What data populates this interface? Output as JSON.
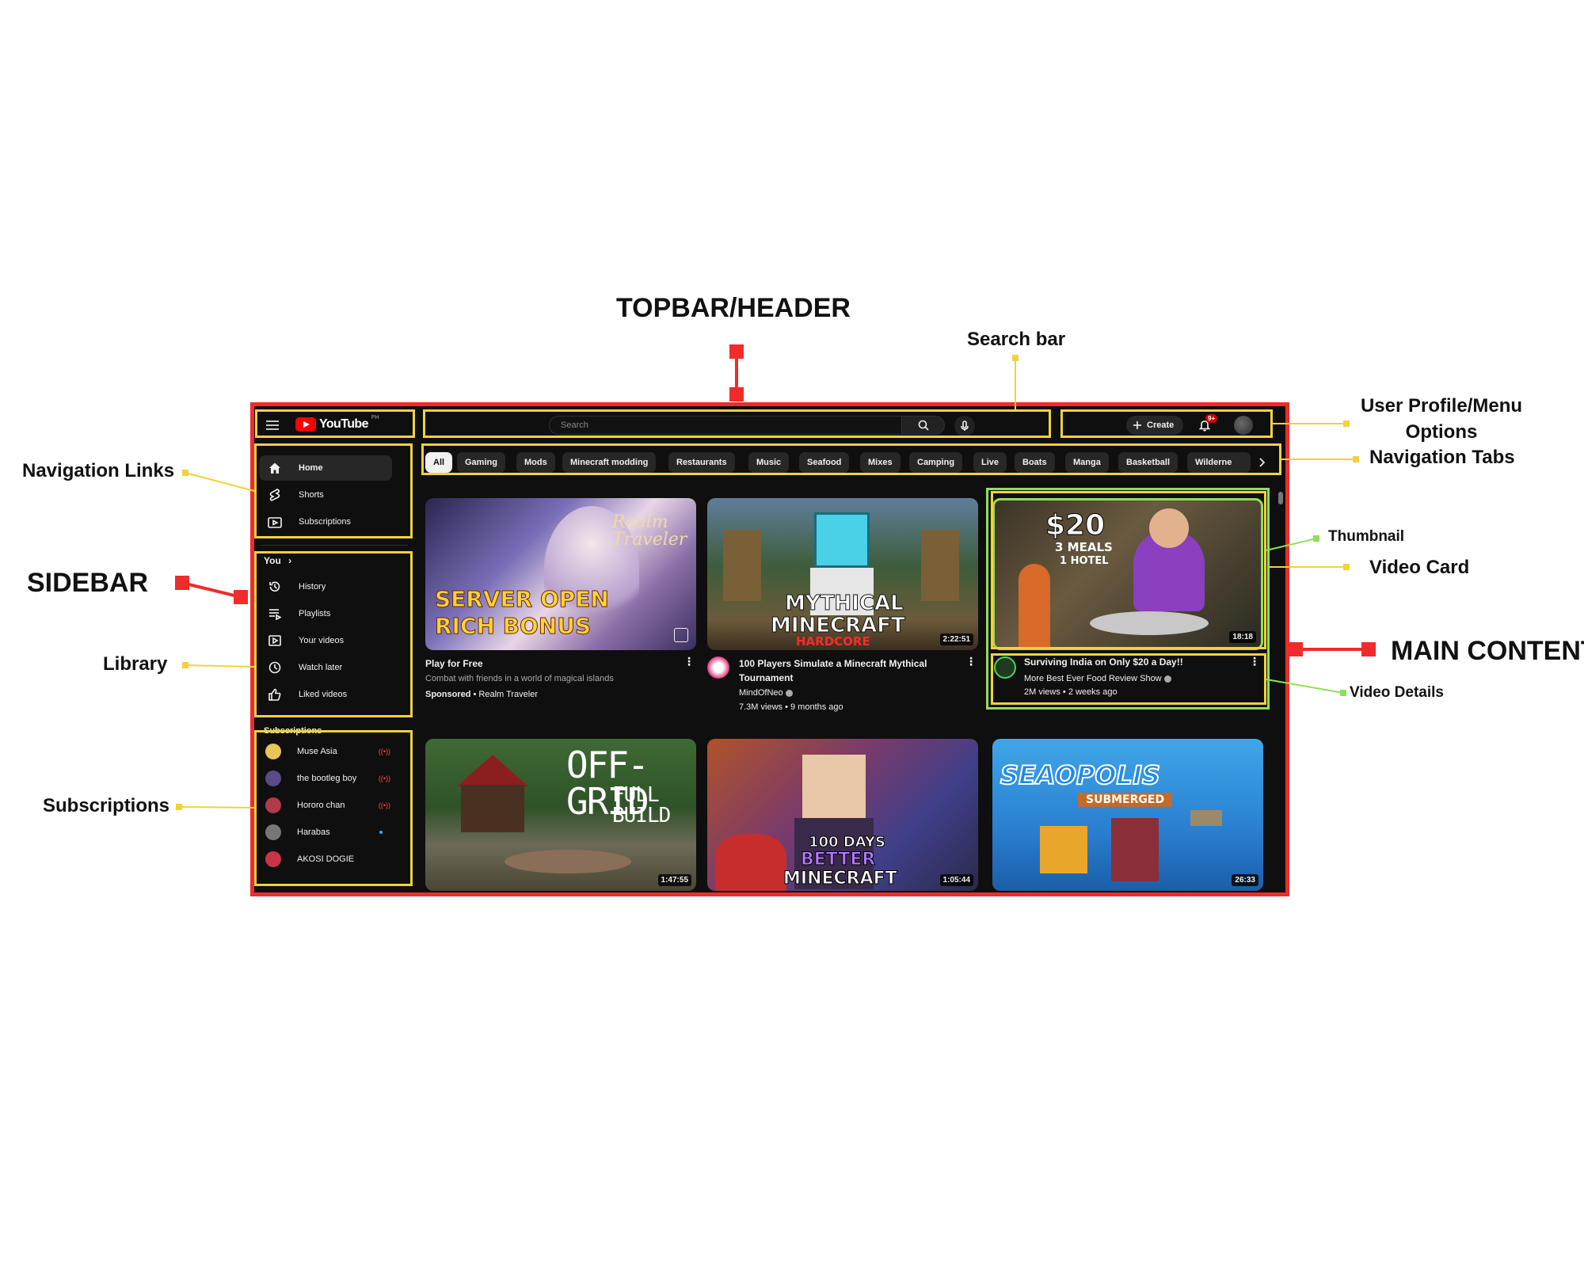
{
  "annotations": {
    "topbar": "TOPBAR/HEADER",
    "search_bar": "Search bar",
    "user_profile": "User Profile/Menu Options",
    "navigation_tabs": "Navigation Tabs",
    "navigation_links": "Navigation Links",
    "sidebar": "SIDEBAR",
    "library": "Library",
    "subscriptions": "Subscriptions",
    "thumbnail": "Thumbnail",
    "video_card": "Video Card",
    "main_content": "MAIN CONTENT",
    "video_details": "Video Details"
  },
  "colors": {
    "annotation_frame": "#ef2b2b",
    "annotation_box": "#f1d23a",
    "annotation_highlight": "#8ee05a",
    "app_background": "#0f0f0f",
    "chip_background": "#272727",
    "brand_red": "#ff0000"
  },
  "header": {
    "logo_text": "YouTube",
    "logo_country": "PH",
    "search_placeholder": "Search",
    "create_label": "Create",
    "notification_badge": "9+"
  },
  "sidebar": {
    "nav": [
      {
        "label": "Home",
        "icon": "home-icon"
      },
      {
        "label": "Shorts",
        "icon": "shorts-icon"
      },
      {
        "label": "Subscriptions",
        "icon": "subscriptions-icon"
      }
    ],
    "you_heading": "You",
    "library": [
      {
        "label": "History",
        "icon": "history-icon"
      },
      {
        "label": "Playlists",
        "icon": "playlists-icon"
      },
      {
        "label": "Your videos",
        "icon": "your-videos-icon"
      },
      {
        "label": "Watch later",
        "icon": "watch-later-icon"
      },
      {
        "label": "Liked videos",
        "icon": "liked-videos-icon"
      }
    ],
    "subscriptions_heading": "Subscriptions",
    "subscriptions": [
      {
        "name": "Muse Asia",
        "status": "live",
        "avatar_color": "#e9c45a"
      },
      {
        "name": "the bootleg boy",
        "status": "live",
        "avatar_color": "#5a4a8a"
      },
      {
        "name": "Hororo chan",
        "status": "live",
        "avatar_color": "#b13a4a"
      },
      {
        "name": "Harabas",
        "status": "new",
        "avatar_color": "#777777"
      },
      {
        "name": "AKOSI DOGIE",
        "status": "",
        "avatar_color": "#c8344a"
      }
    ],
    "live_glyph": "((•))"
  },
  "chips": [
    "All",
    "Gaming",
    "Mods",
    "Minecraft modding",
    "Restaurants",
    "Music",
    "Seafood",
    "Mixes",
    "Camping",
    "Live",
    "Boats",
    "Manga",
    "Basketball",
    "Wilderne"
  ],
  "videos": [
    {
      "title": "Play for Free",
      "description": "Combat with friends in a world of magical islands",
      "sponsored_label": "Sponsored",
      "channel": "Realm Traveler",
      "thumb_text_1": "SERVER OPEN",
      "thumb_text_2": "RICH BONUS",
      "thumb_logo": "Realm Traveler"
    },
    {
      "title": "100 Players Simulate a Minecraft Mythical Tournament",
      "channel": "MindOfNeo",
      "views": "7.3M views",
      "age": "9 months ago",
      "duration": "2:22:51",
      "thumb_text_1": "MYTHICAL",
      "thumb_text_2": "MINECRAFT",
      "thumb_text_3": "HARDCORE"
    },
    {
      "title": "Surviving India on Only $20 a Day!!",
      "channel": "More Best Ever Food Review Show",
      "views": "2M views",
      "age": "2 weeks ago",
      "duration": "18:18",
      "thumb_text_1": "$20",
      "thumb_text_2": "3 MEALS",
      "thumb_text_3": "1 HOTEL"
    },
    {
      "duration": "1:47:55",
      "thumb_text_1": "OFF-GRID",
      "thumb_text_2": "FULL BUILD"
    },
    {
      "duration": "1:05:44",
      "thumb_text_1": "100 DAYS",
      "thumb_text_2": "BETTER",
      "thumb_text_3": "MINECRAFT"
    },
    {
      "duration": "26:33",
      "thumb_text_1": "SEAOPOLIS",
      "thumb_text_2": "SUBMERGED"
    }
  ],
  "separator": " • "
}
